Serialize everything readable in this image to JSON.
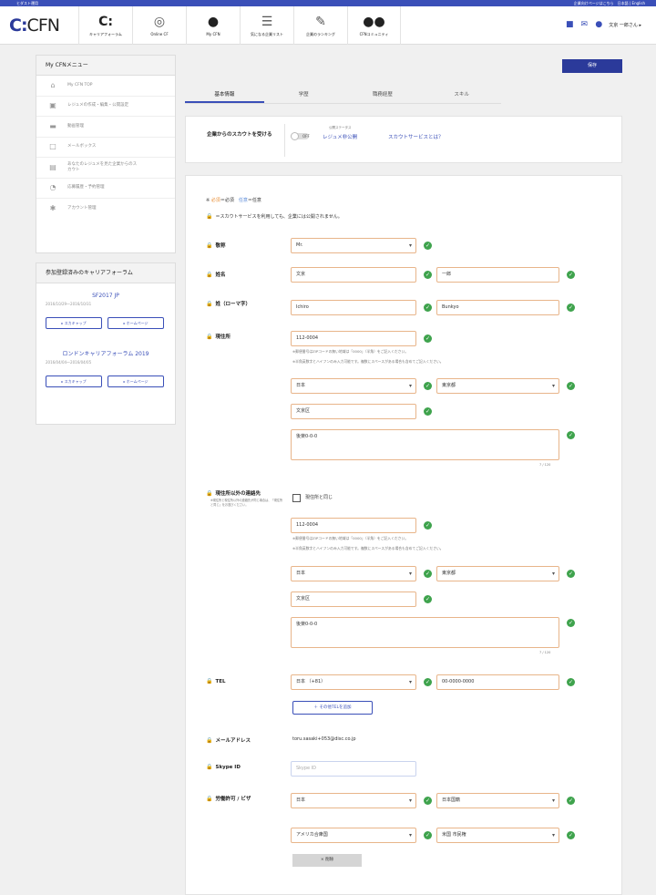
{
  "topbar": {
    "left": "ヒダスト運用",
    "right": "企業向けページはこちら　日本語 | English"
  },
  "header": {
    "logo_mark": "C:",
    "logo_text": "CFN",
    "nav": [
      {
        "label": "キャリアフォーラム",
        "icon": "cf-logo-icon"
      },
      {
        "label": "Online CF",
        "icon": "globe-icon"
      },
      {
        "label": "My CFN",
        "icon": "person-icon"
      },
      {
        "label": "気になる企業リスト",
        "icon": "list-icon"
      },
      {
        "label": "企業のランキング",
        "icon": "edit-icon"
      },
      {
        "label": "CFNコミュニティ",
        "icon": "people-icon"
      }
    ],
    "user_name": "文京 一郎さん ▸"
  },
  "sidebar": {
    "menu_title": "My CFNメニュー",
    "items": [
      {
        "label": "My CFN TOP",
        "icon": "home-icon"
      },
      {
        "label": "レジュメの作成・編集・公開設定",
        "icon": "resume-icon"
      },
      {
        "label": "動画管理",
        "icon": "video-icon"
      },
      {
        "label": "メールボックス",
        "icon": "mail-icon"
      },
      {
        "label": "あなたのレジュメを見た企業からのスカウト",
        "icon": "building-icon"
      },
      {
        "label": "応募履歴・予約管理",
        "icon": "history-icon"
      },
      {
        "label": "アカウント管理",
        "icon": "gear-icon"
      }
    ],
    "forum_title": "参加登録済みのキャリアフォーラム",
    "forums": [
      {
        "name": "SF2017 JP",
        "dates": "2016/10/29〜2016/10/31",
        "btn1": "スカキャップ",
        "btn2": "ホームページ"
      },
      {
        "name": "ロンドンキャリアフォーラム 2019",
        "dates": "2016/04/04〜2016/04/05",
        "btn1": "スカキャップ",
        "btn2": "ホームページ"
      }
    ]
  },
  "save_button": "保存",
  "tabs": [
    "基本情報",
    "学歴",
    "職務経歴",
    "スキル"
  ],
  "scout": {
    "label": "企業からのスカウトを受ける",
    "toggle_state": "OFF",
    "public_status_label": "公開ステータス",
    "public_status": "レジュメ非公開",
    "link": "スカウトサービスとは？"
  },
  "form": {
    "legend_prefix": "※",
    "legend_required": "必須",
    "legend_mid": "＝必須",
    "legend_optional": "任意",
    "legend_suffix": "＝任意",
    "lock_note": "＝スカウトサービスを利用しても、企業には公開されません。",
    "title_label": "敬称",
    "title_value": "Mr.",
    "name_label": "姓名",
    "last_name": "文京",
    "first_name": "一郎",
    "romaji_label": "姓（ローマ字）",
    "last_name_romaji": "Ichiro",
    "first_name_romaji": "Bunkyo",
    "address_label": "現住所",
    "postal": "112-0004",
    "note1": "※郵便番号はZIPコードの無い地域は「0000」（半角）をご記入ください。",
    "note2": "※半角英数字とハイフンのみ入力可能です。複数にスペースがある場合も含めてご記入ください。",
    "country": "日本",
    "prefecture": "東京都",
    "city": "文京区",
    "street": "後楽0-0-0",
    "counter": "7 / 120",
    "alt_address_label": "現住所以外の連絡先",
    "alt_address_note": "※現住所と現住所以外の連絡先が同じ場合は、「現住所と同じ」をお選びください。",
    "same_as_address": "現住所と同じ",
    "alt_postal": "112-0004",
    "alt_country": "日本",
    "alt_prefecture": "東京都",
    "alt_city": "文京区",
    "alt_street": "後楽0-0-0",
    "alt_counter": "7 / 120",
    "tel_label": "TEL",
    "tel_country": "日本 （+81）",
    "tel_number": "00-0000-0000",
    "add_tel": "＋ その他TELを追加",
    "email_label": "メールアドレス",
    "email": "toru.sasaki+053@disc.co.jp",
    "skype_label": "Skype ID",
    "skype_placeholder": "Skype ID",
    "visa_label": "労働許可 / ビザ",
    "visa1_country": "日本",
    "visa1_type": "日本国籍",
    "visa2_country": "アメリカ合衆国",
    "visa2_type": "米国 市民権",
    "delete_button": "× 削除"
  },
  "colors": {
    "brand": "#2b3a9a",
    "accent": "#3a4fb8",
    "required": "#e8903a",
    "input_border": "#e8b58a",
    "check": "#3fa34d"
  }
}
